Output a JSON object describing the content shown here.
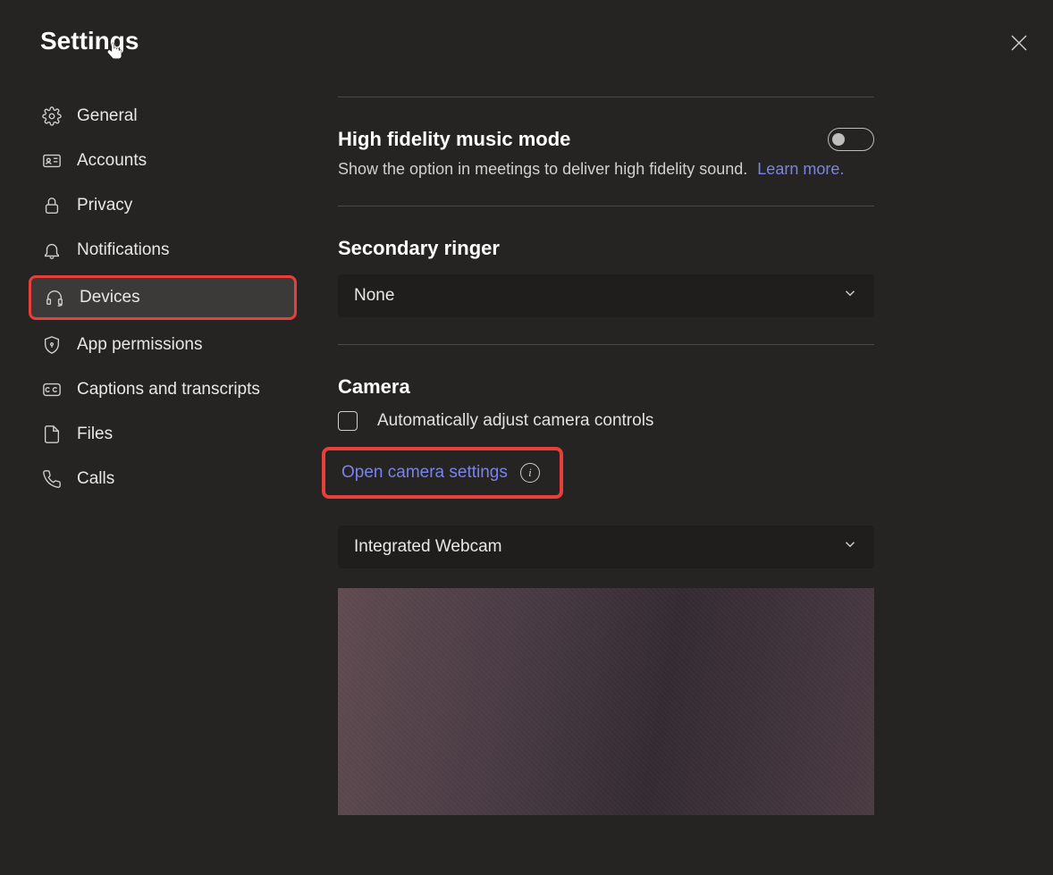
{
  "header": {
    "title": "Settings"
  },
  "sidebar": {
    "items": [
      {
        "label": "General"
      },
      {
        "label": "Accounts"
      },
      {
        "label": "Privacy"
      },
      {
        "label": "Notifications"
      },
      {
        "label": "Devices"
      },
      {
        "label": "App permissions"
      },
      {
        "label": "Captions and transcripts"
      },
      {
        "label": "Files"
      },
      {
        "label": "Calls"
      }
    ]
  },
  "main": {
    "hifi": {
      "title": "High fidelity music mode",
      "desc": "Show the option in meetings to deliver high fidelity sound.",
      "learn_more": "Learn more."
    },
    "ringer": {
      "title": "Secondary ringer",
      "value": "None"
    },
    "camera": {
      "title": "Camera",
      "auto_adjust": "Automatically adjust camera controls",
      "open_settings": "Open camera settings",
      "device": "Integrated Webcam"
    }
  }
}
